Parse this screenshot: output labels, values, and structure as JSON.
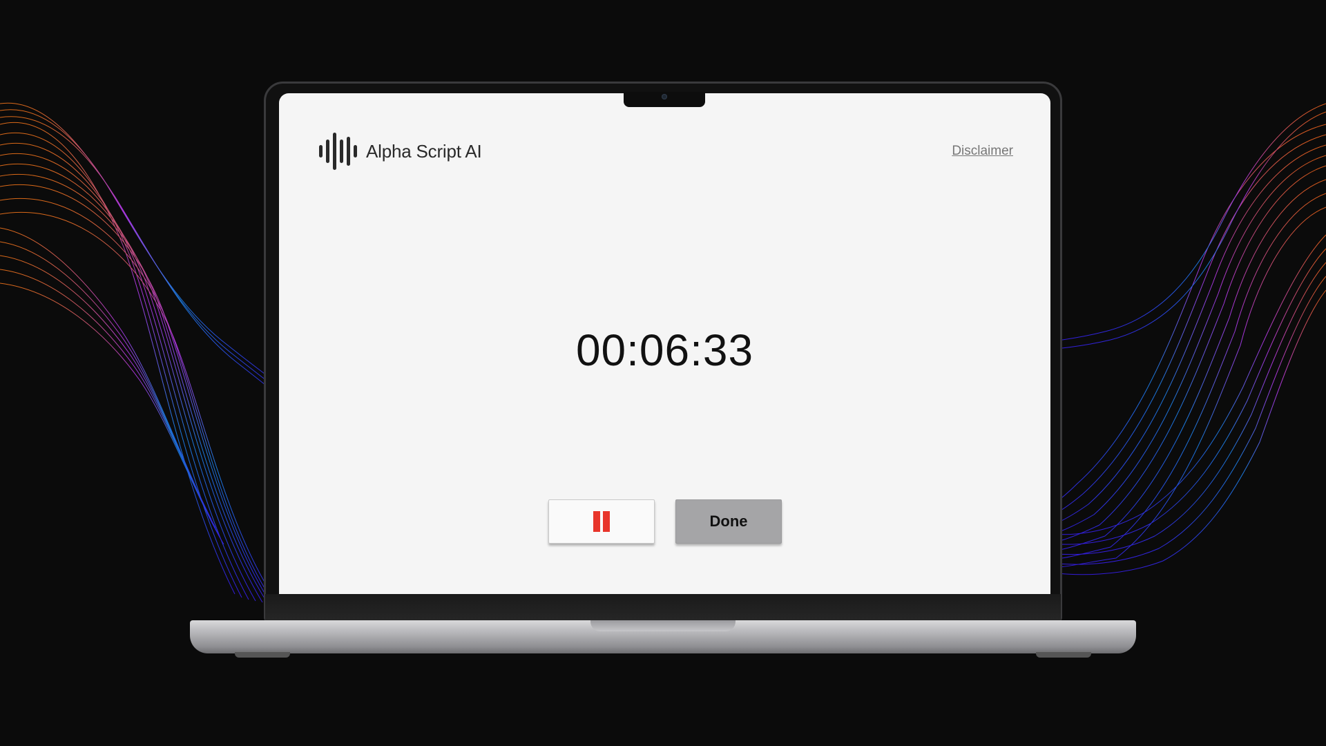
{
  "app": {
    "name": "Alpha Script AI",
    "disclaimer_link": "Disclaimer",
    "logo_icon": "sound-wave-icon"
  },
  "recorder": {
    "elapsed": "00:06:33",
    "pause_icon": "pause-icon",
    "done_label": "Done"
  },
  "colors": {
    "accent_pause": "#e8352b",
    "done_button": "#a5a5a7",
    "screen_background": "#f5f5f5",
    "page_background": "#0b0b0b"
  }
}
